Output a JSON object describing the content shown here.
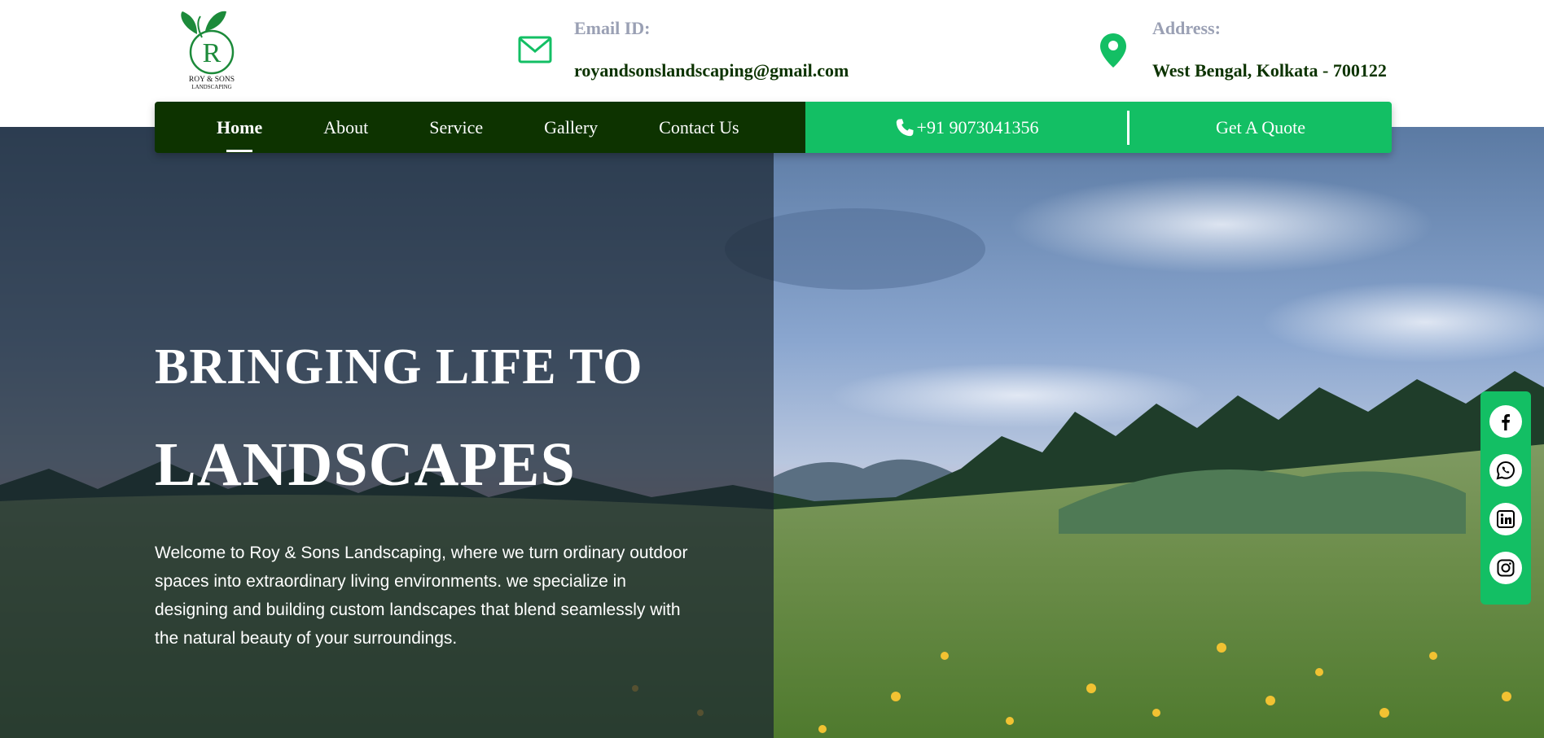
{
  "brand": {
    "logo_monogram": "R",
    "logo_line1": "ROY & SONS",
    "logo_line2": "LANDSCAPING"
  },
  "contact": {
    "email_label": "Email ID:",
    "email_value": "royandsonslandscaping@gmail.com",
    "address_label": "Address:",
    "address_value": "West Bengal, Kolkata - 700122",
    "email_icon": "mail-icon",
    "address_icon": "location-pin-icon"
  },
  "nav": {
    "items": [
      {
        "label": "Home",
        "active": true
      },
      {
        "label": "About",
        "active": false
      },
      {
        "label": "Service",
        "active": false
      },
      {
        "label": "Gallery",
        "active": false
      },
      {
        "label": "Contact Us",
        "active": false
      }
    ],
    "phone": "+91 9073041356",
    "phone_icon": "phone-icon",
    "quote_label": "Get A Quote"
  },
  "hero": {
    "headline_line1": "BRINGING LIFE TO",
    "headline_line2": "LANDSCAPES",
    "intro": "Welcome to Roy & Sons Landscaping, where we turn ordinary outdoor spaces into extraordinary living environments. we specialize in designing and building custom landscapes that blend seamlessly with the natural beauty of your surroundings."
  },
  "social": [
    {
      "name": "facebook-icon"
    },
    {
      "name": "whatsapp-icon"
    },
    {
      "name": "linkedin-icon"
    },
    {
      "name": "instagram-icon"
    }
  ],
  "colors": {
    "nav_dark": "#0d3300",
    "accent_green": "#13bf64",
    "text_dark_green": "#0c3300",
    "label_gray": "#9aa0b4"
  }
}
